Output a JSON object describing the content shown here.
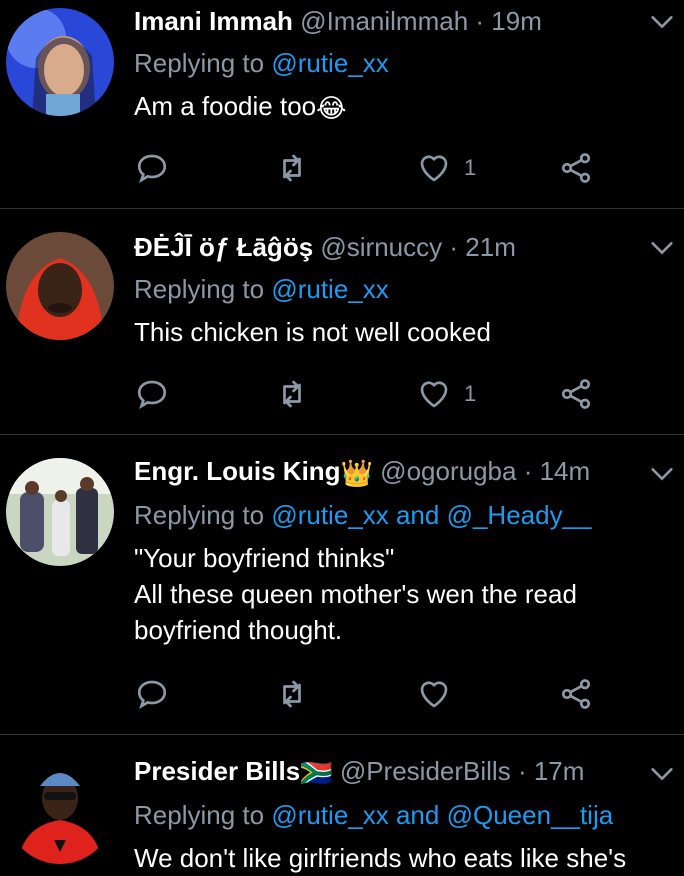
{
  "tweets": [
    {
      "name": "Imani Immah",
      "handle": "@Imanilmmah",
      "time": "19m",
      "reply_prefix": "Replying to",
      "reply_mentions": "@rutie_xx",
      "text": "Am a foodie too",
      "text_emoji": "😂",
      "like_count": "1"
    },
    {
      "name": "ĐĖĴĪ öƒ Łāĝöş",
      "handle": "@sirnuccy",
      "time": "21m",
      "reply_prefix": "Replying to",
      "reply_mentions": "@rutie_xx",
      "text": "This chicken is not well cooked",
      "like_count": "1"
    },
    {
      "name": "Engr. Louis King",
      "name_emoji": "👑",
      "handle": "@ogorugba",
      "time": "14m",
      "reply_prefix": "Replying to",
      "reply_mentions": "@rutie_xx and @_Heady__",
      "text_line1": "\"Your boyfriend thinks\"",
      "text_line2": "All these queen mother's wen the read boyfriend thought.",
      "like_count": ""
    },
    {
      "name": "Presider Bills",
      "name_emoji": "🇿🇦",
      "handle": "@PresiderBills",
      "time": "17m",
      "reply_prefix": "Replying to",
      "reply_mentions": "@rutie_xx and @Queen__tija",
      "text": "We don't like girlfriends who eats like she's"
    }
  ],
  "separator": "·",
  "colors": {
    "background": "#000000",
    "accent": "#1d9bf0",
    "secondary_text": "#8b98a5",
    "divider": "#2f3336"
  },
  "icons": [
    "reply-icon",
    "retweet-icon",
    "like-icon",
    "share-icon",
    "caret-down-icon"
  ]
}
